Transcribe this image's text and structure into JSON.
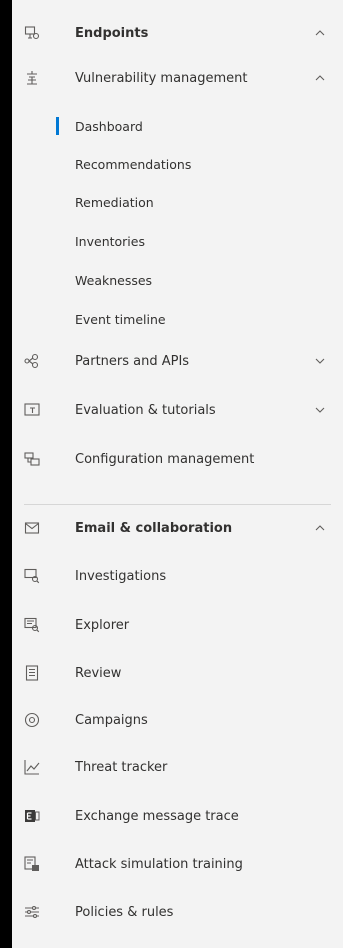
{
  "nav": {
    "endpoints": {
      "label": "Endpoints"
    },
    "vuln": {
      "label": "Vulnerability management"
    },
    "vuln_children": [
      {
        "label": "Dashboard"
      },
      {
        "label": "Recommendations"
      },
      {
        "label": "Remediation"
      },
      {
        "label": "Inventories"
      },
      {
        "label": "Weaknesses"
      },
      {
        "label": "Event timeline"
      }
    ],
    "partners": {
      "label": "Partners and APIs"
    },
    "evaluation": {
      "label": "Evaluation & tutorials"
    },
    "config": {
      "label": "Configuration management"
    },
    "email": {
      "label": "Email & collaboration"
    },
    "email_items": [
      {
        "label": "Investigations",
        "icon": "investigations-icon"
      },
      {
        "label": "Explorer",
        "icon": "explorer-icon"
      },
      {
        "label": "Review",
        "icon": "review-icon"
      },
      {
        "label": "Campaigns",
        "icon": "campaigns-icon"
      },
      {
        "label": "Threat tracker",
        "icon": "threat-tracker-icon"
      },
      {
        "label": "Exchange message trace",
        "icon": "exchange-icon"
      },
      {
        "label": "Attack simulation training",
        "icon": "attack-simulation-icon"
      },
      {
        "label": "Policies & rules",
        "icon": "policies-icon"
      }
    ]
  },
  "colors": {
    "accent": "#0078d4",
    "background": "#f3f3f3",
    "text": "#323130",
    "icon": "#605e5c"
  }
}
